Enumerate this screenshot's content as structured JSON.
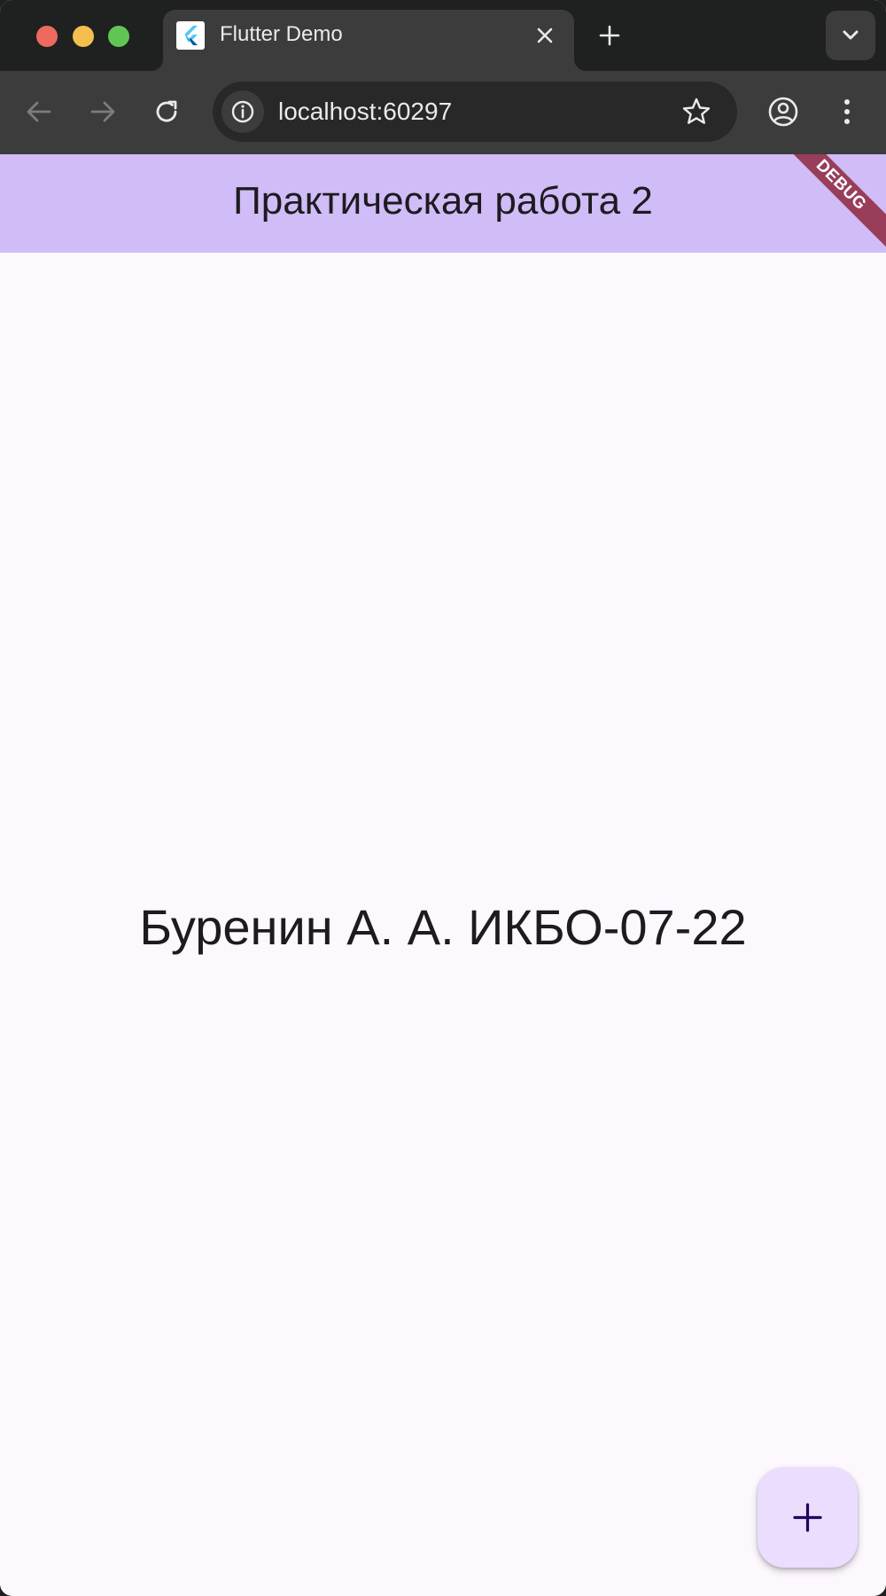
{
  "browser": {
    "tab": {
      "title": "Flutter Demo"
    },
    "address_bar": {
      "url": "localhost:60297"
    }
  },
  "app": {
    "appbar": {
      "title": "Практическая работа 2"
    },
    "debug_banner": "DEBUG",
    "body": {
      "text": "Буренин А. А. ИКБО-07-22"
    },
    "fab": {
      "icon": "add-icon"
    }
  },
  "colors": {
    "appbar": "#d0bcf6",
    "background": "#fdf7fe",
    "fab": "#eaddfe",
    "debug_ribbon": "#881a2e"
  }
}
